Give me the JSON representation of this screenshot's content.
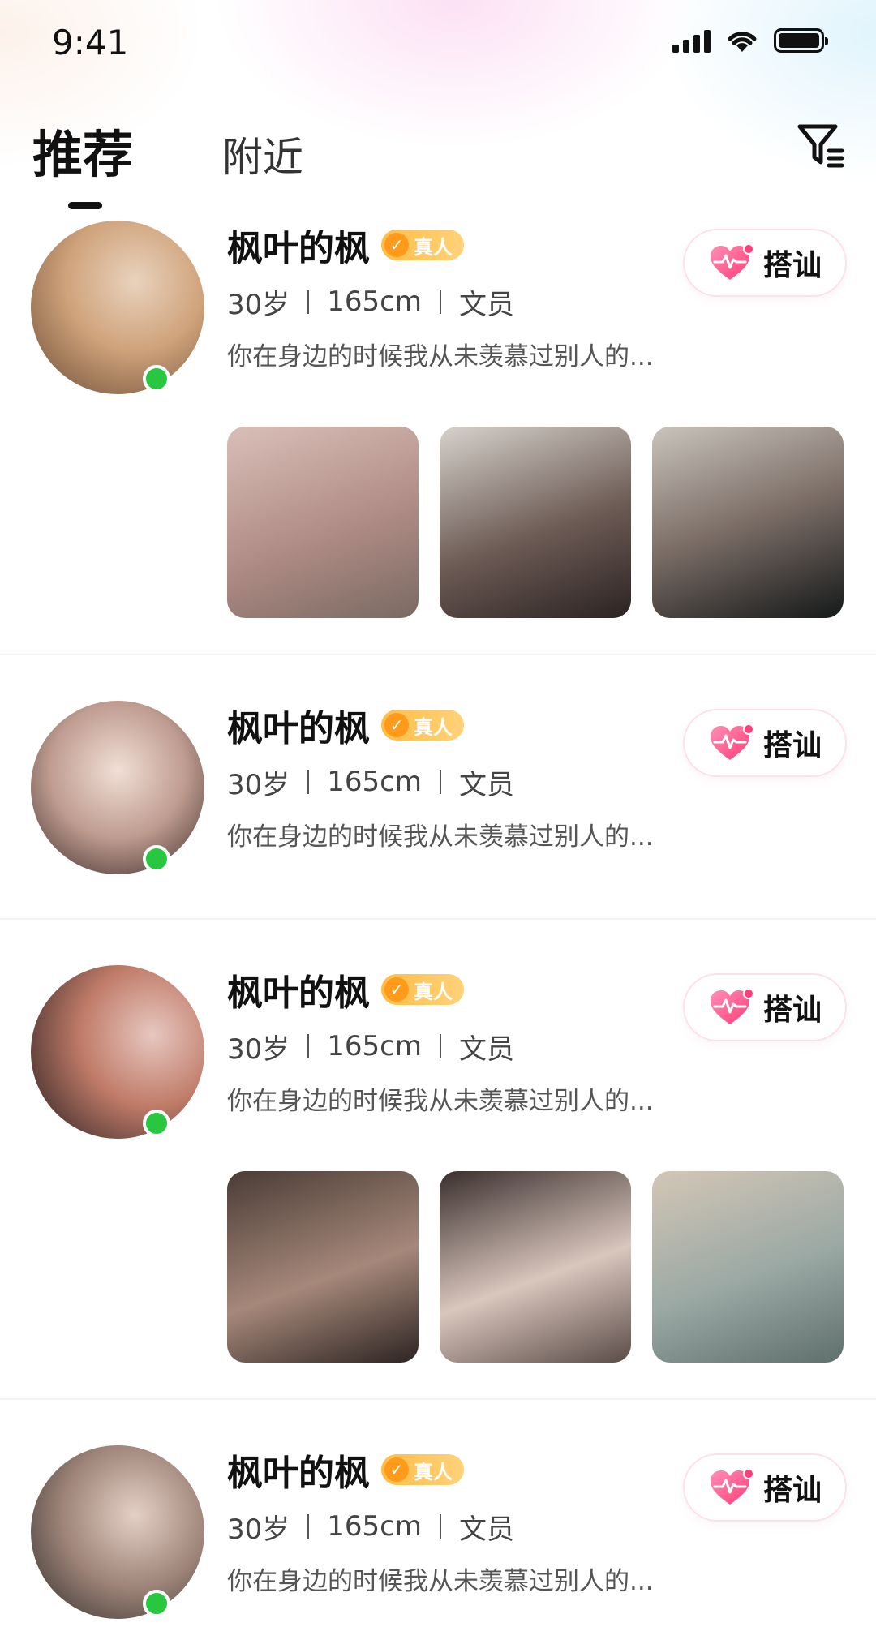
{
  "status_bar": {
    "time": "9:41"
  },
  "tabs": [
    {
      "label": "推荐",
      "active": true
    },
    {
      "label": "附近",
      "active": false
    }
  ],
  "icons": {
    "filter": "filter-icon",
    "heart": "heart-pulse-icon",
    "check": "check-badge-icon"
  },
  "colors": {
    "online": "#27c840",
    "badge": "#ffbd45",
    "heart": "#ff4f86"
  },
  "cards": [
    {
      "name": "枫叶的枫",
      "badge": "真人",
      "age": "30岁",
      "height": "165cm",
      "job": "文员",
      "bio": "你在身边的时候我从未羡慕过别人的...",
      "action": "搭讪",
      "online": true,
      "photo_count": 3
    },
    {
      "name": "枫叶的枫",
      "badge": "真人",
      "age": "30岁",
      "height": "165cm",
      "job": "文员",
      "bio": "你在身边的时候我从未羡慕过别人的...",
      "action": "搭讪",
      "online": true,
      "photo_count": 0
    },
    {
      "name": "枫叶的枫",
      "badge": "真人",
      "age": "30岁",
      "height": "165cm",
      "job": "文员",
      "bio": "你在身边的时候我从未羡慕过别人的...",
      "action": "搭讪",
      "online": true,
      "photo_count": 3
    },
    {
      "name": "枫叶的枫",
      "badge": "真人",
      "age": "30岁",
      "height": "165cm",
      "job": "文员",
      "bio": "你在身边的时候我从未羡慕过别人的...",
      "action": "搭讪",
      "online": true,
      "photo_count": 0
    }
  ]
}
